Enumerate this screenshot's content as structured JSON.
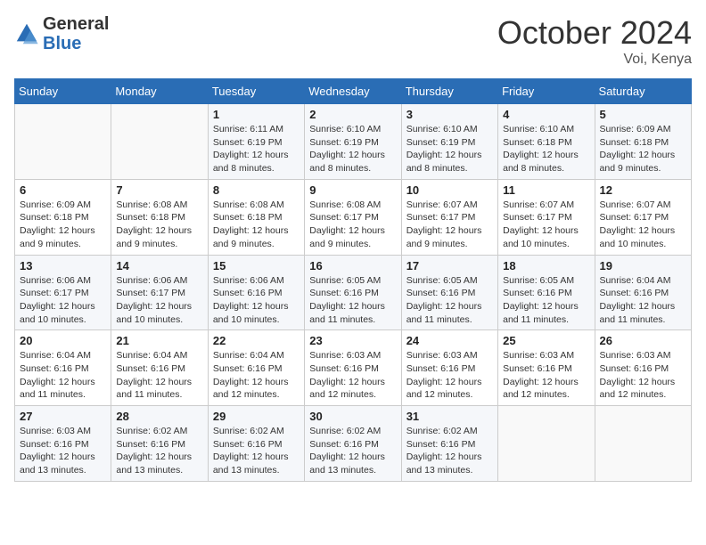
{
  "header": {
    "logo_general": "General",
    "logo_blue": "Blue",
    "month_year": "October 2024",
    "location": "Voi, Kenya"
  },
  "days_of_week": [
    "Sunday",
    "Monday",
    "Tuesday",
    "Wednesday",
    "Thursday",
    "Friday",
    "Saturday"
  ],
  "weeks": [
    [
      {
        "day": "",
        "info": ""
      },
      {
        "day": "",
        "info": ""
      },
      {
        "day": "1",
        "info": "Sunrise: 6:11 AM\nSunset: 6:19 PM\nDaylight: 12 hours and 8 minutes."
      },
      {
        "day": "2",
        "info": "Sunrise: 6:10 AM\nSunset: 6:19 PM\nDaylight: 12 hours and 8 minutes."
      },
      {
        "day": "3",
        "info": "Sunrise: 6:10 AM\nSunset: 6:19 PM\nDaylight: 12 hours and 8 minutes."
      },
      {
        "day": "4",
        "info": "Sunrise: 6:10 AM\nSunset: 6:18 PM\nDaylight: 12 hours and 8 minutes."
      },
      {
        "day": "5",
        "info": "Sunrise: 6:09 AM\nSunset: 6:18 PM\nDaylight: 12 hours and 9 minutes."
      }
    ],
    [
      {
        "day": "6",
        "info": "Sunrise: 6:09 AM\nSunset: 6:18 PM\nDaylight: 12 hours and 9 minutes."
      },
      {
        "day": "7",
        "info": "Sunrise: 6:08 AM\nSunset: 6:18 PM\nDaylight: 12 hours and 9 minutes."
      },
      {
        "day": "8",
        "info": "Sunrise: 6:08 AM\nSunset: 6:18 PM\nDaylight: 12 hours and 9 minutes."
      },
      {
        "day": "9",
        "info": "Sunrise: 6:08 AM\nSunset: 6:17 PM\nDaylight: 12 hours and 9 minutes."
      },
      {
        "day": "10",
        "info": "Sunrise: 6:07 AM\nSunset: 6:17 PM\nDaylight: 12 hours and 9 minutes."
      },
      {
        "day": "11",
        "info": "Sunrise: 6:07 AM\nSunset: 6:17 PM\nDaylight: 12 hours and 10 minutes."
      },
      {
        "day": "12",
        "info": "Sunrise: 6:07 AM\nSunset: 6:17 PM\nDaylight: 12 hours and 10 minutes."
      }
    ],
    [
      {
        "day": "13",
        "info": "Sunrise: 6:06 AM\nSunset: 6:17 PM\nDaylight: 12 hours and 10 minutes."
      },
      {
        "day": "14",
        "info": "Sunrise: 6:06 AM\nSunset: 6:17 PM\nDaylight: 12 hours and 10 minutes."
      },
      {
        "day": "15",
        "info": "Sunrise: 6:06 AM\nSunset: 6:16 PM\nDaylight: 12 hours and 10 minutes."
      },
      {
        "day": "16",
        "info": "Sunrise: 6:05 AM\nSunset: 6:16 PM\nDaylight: 12 hours and 11 minutes."
      },
      {
        "day": "17",
        "info": "Sunrise: 6:05 AM\nSunset: 6:16 PM\nDaylight: 12 hours and 11 minutes."
      },
      {
        "day": "18",
        "info": "Sunrise: 6:05 AM\nSunset: 6:16 PM\nDaylight: 12 hours and 11 minutes."
      },
      {
        "day": "19",
        "info": "Sunrise: 6:04 AM\nSunset: 6:16 PM\nDaylight: 12 hours and 11 minutes."
      }
    ],
    [
      {
        "day": "20",
        "info": "Sunrise: 6:04 AM\nSunset: 6:16 PM\nDaylight: 12 hours and 11 minutes."
      },
      {
        "day": "21",
        "info": "Sunrise: 6:04 AM\nSunset: 6:16 PM\nDaylight: 12 hours and 11 minutes."
      },
      {
        "day": "22",
        "info": "Sunrise: 6:04 AM\nSunset: 6:16 PM\nDaylight: 12 hours and 12 minutes."
      },
      {
        "day": "23",
        "info": "Sunrise: 6:03 AM\nSunset: 6:16 PM\nDaylight: 12 hours and 12 minutes."
      },
      {
        "day": "24",
        "info": "Sunrise: 6:03 AM\nSunset: 6:16 PM\nDaylight: 12 hours and 12 minutes."
      },
      {
        "day": "25",
        "info": "Sunrise: 6:03 AM\nSunset: 6:16 PM\nDaylight: 12 hours and 12 minutes."
      },
      {
        "day": "26",
        "info": "Sunrise: 6:03 AM\nSunset: 6:16 PM\nDaylight: 12 hours and 12 minutes."
      }
    ],
    [
      {
        "day": "27",
        "info": "Sunrise: 6:03 AM\nSunset: 6:16 PM\nDaylight: 12 hours and 13 minutes."
      },
      {
        "day": "28",
        "info": "Sunrise: 6:02 AM\nSunset: 6:16 PM\nDaylight: 12 hours and 13 minutes."
      },
      {
        "day": "29",
        "info": "Sunrise: 6:02 AM\nSunset: 6:16 PM\nDaylight: 12 hours and 13 minutes."
      },
      {
        "day": "30",
        "info": "Sunrise: 6:02 AM\nSunset: 6:16 PM\nDaylight: 12 hours and 13 minutes."
      },
      {
        "day": "31",
        "info": "Sunrise: 6:02 AM\nSunset: 6:16 PM\nDaylight: 12 hours and 13 minutes."
      },
      {
        "day": "",
        "info": ""
      },
      {
        "day": "",
        "info": ""
      }
    ]
  ]
}
